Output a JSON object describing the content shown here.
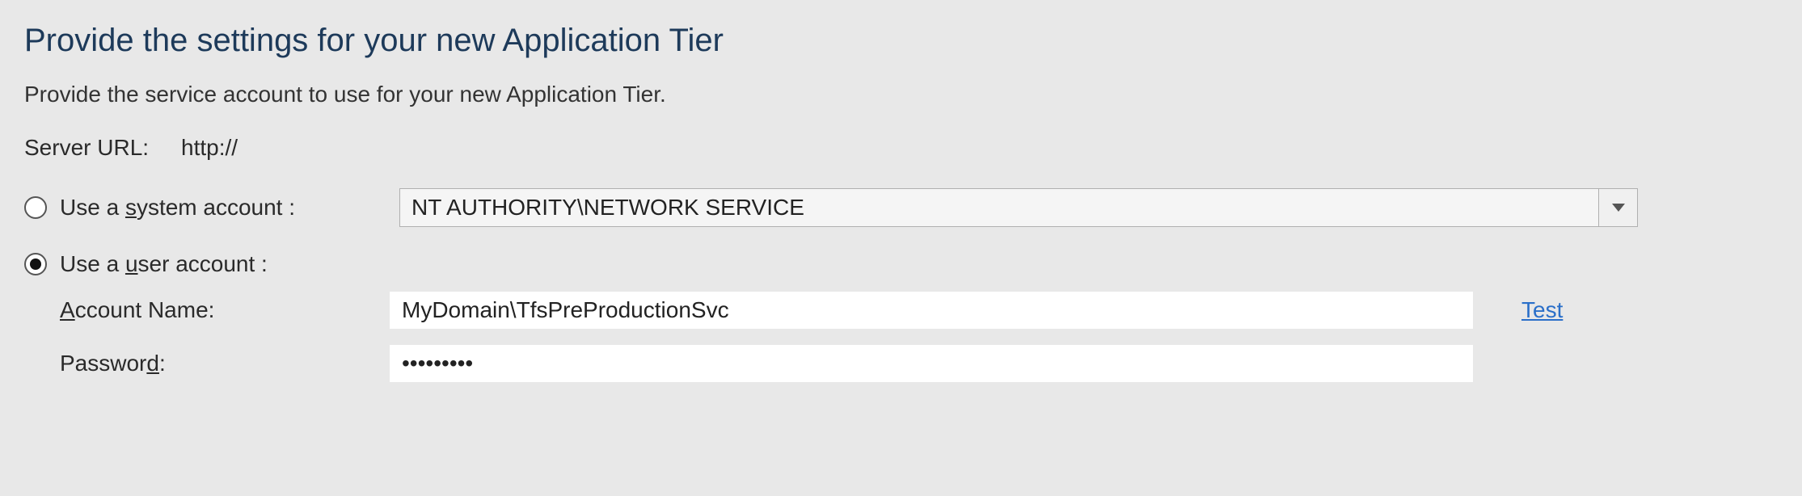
{
  "heading": "Provide the settings for your new Application Tier",
  "description": "Provide the service account to use for your new Application Tier.",
  "server_url": {
    "label": "Server URL:",
    "value": "http://"
  },
  "options": {
    "system_account": {
      "label_pre": "Use a ",
      "label_u": "s",
      "label_post": "ystem account :",
      "combo_value": "NT AUTHORITY\\NETWORK SERVICE"
    },
    "user_account": {
      "label_pre": "Use a ",
      "label_u": "u",
      "label_post": "ser account :"
    }
  },
  "fields": {
    "account_name": {
      "label_u": "A",
      "label_post": "ccount Name:",
      "value": "MyDomain\\TfsPreProductionSvc"
    },
    "password": {
      "label_pre": "Passwor",
      "label_u": "d",
      "label_post": ":",
      "value": "•••••••••"
    }
  },
  "test_link": "Test"
}
